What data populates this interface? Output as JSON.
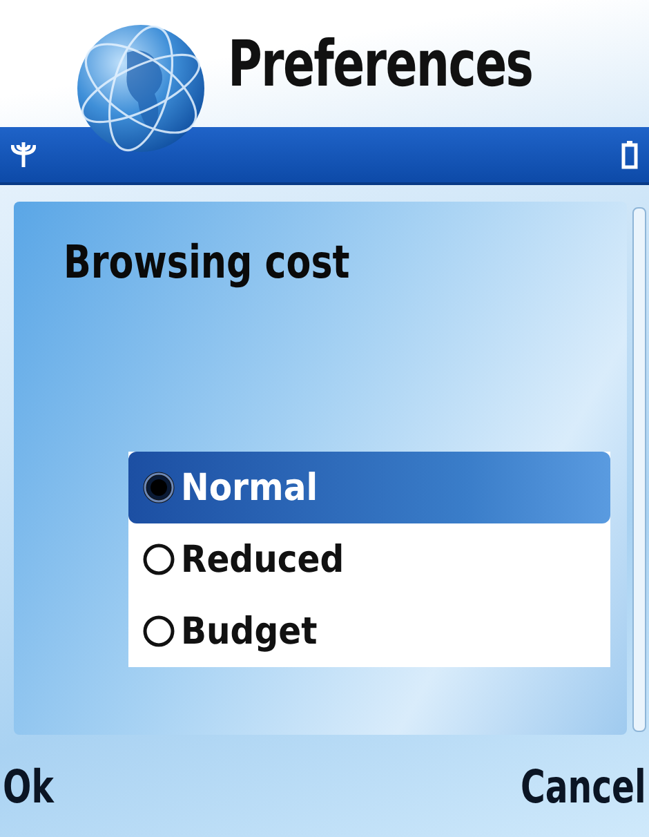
{
  "window": {
    "title": "Preferences"
  },
  "dialog": {
    "heading": "Browsing cost",
    "options": [
      {
        "label": "Normal",
        "selected": true
      },
      {
        "label": "Reduced",
        "selected": false
      },
      {
        "label": "Budget",
        "selected": false
      }
    ]
  },
  "softkeys": {
    "left": "Ok",
    "right": "Cancel"
  }
}
